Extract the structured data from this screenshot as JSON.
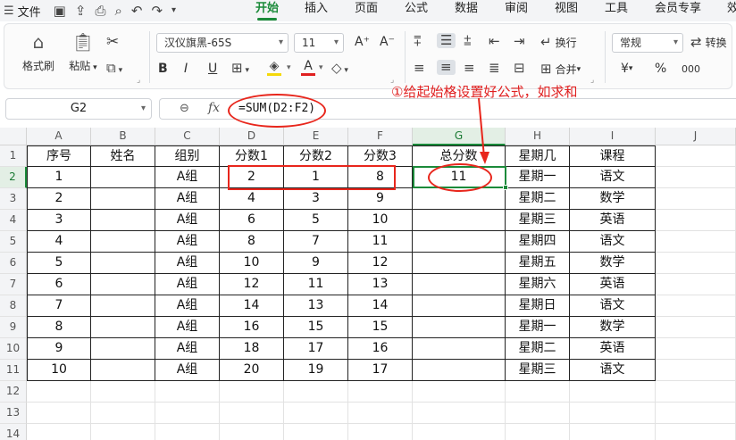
{
  "menubar": {
    "file_label": "文件",
    "tabs": [
      "开始",
      "插入",
      "页面",
      "公式",
      "数据",
      "审阅",
      "视图",
      "工具",
      "会员专享",
      "效"
    ],
    "active_tab": "开始"
  },
  "ribbon": {
    "format_painter": "格式刷",
    "paste": "粘贴",
    "font_name": "汉仪旗黑-65S",
    "font_size": "11",
    "bold": "B",
    "italic": "I",
    "underline": "U",
    "font_color_letter": "A",
    "font_grow": "A⁺",
    "font_shrink": "A⁻",
    "wrap": "换行",
    "merge": "合并",
    "number_format": "常规",
    "convert": "转换",
    "currency": "¥",
    "percent": "%",
    "thousands": "000",
    "accent_color": "#1b8a3a",
    "font_color": "#e02020",
    "fill_color": "#f5d90a"
  },
  "formula_bar": {
    "name_box": "G2",
    "fx": "fx",
    "formula": "=SUM(D2:F2)"
  },
  "annotation": {
    "text": "①给起始格设置好公式，如求和",
    "color": "#e02020"
  },
  "sheet": {
    "columns": [
      "A",
      "B",
      "C",
      "D",
      "E",
      "F",
      "G",
      "H",
      "I",
      "J"
    ],
    "row_numbers": [
      "1",
      "2",
      "3",
      "4",
      "5",
      "6",
      "7",
      "8",
      "9",
      "10",
      "11",
      "12",
      "13",
      "14"
    ],
    "headers": [
      "序号",
      "姓名",
      "组别",
      "分数1",
      "分数2",
      "分数3",
      "总分数",
      "星期几",
      "课程"
    ],
    "rows": [
      [
        "1",
        "",
        "A组",
        "2",
        "1",
        "8",
        "11",
        "星期一",
        "语文"
      ],
      [
        "2",
        "",
        "A组",
        "4",
        "3",
        "9",
        "",
        "星期二",
        "数学"
      ],
      [
        "3",
        "",
        "A组",
        "6",
        "5",
        "10",
        "",
        "星期三",
        "英语"
      ],
      [
        "4",
        "",
        "A组",
        "8",
        "7",
        "11",
        "",
        "星期四",
        "语文"
      ],
      [
        "5",
        "",
        "A组",
        "10",
        "9",
        "12",
        "",
        "星期五",
        "数学"
      ],
      [
        "6",
        "",
        "A组",
        "12",
        "11",
        "13",
        "",
        "星期六",
        "英语"
      ],
      [
        "7",
        "",
        "A组",
        "14",
        "13",
        "14",
        "",
        "星期日",
        "语文"
      ],
      [
        "8",
        "",
        "A组",
        "16",
        "15",
        "15",
        "",
        "星期一",
        "数学"
      ],
      [
        "9",
        "",
        "A组",
        "18",
        "17",
        "16",
        "",
        "星期二",
        "英语"
      ],
      [
        "10",
        "",
        "A组",
        "20",
        "19",
        "17",
        "",
        "星期三",
        "语文"
      ]
    ],
    "selected_cell": "G2",
    "selected_column": "G",
    "selected_row": "2"
  }
}
